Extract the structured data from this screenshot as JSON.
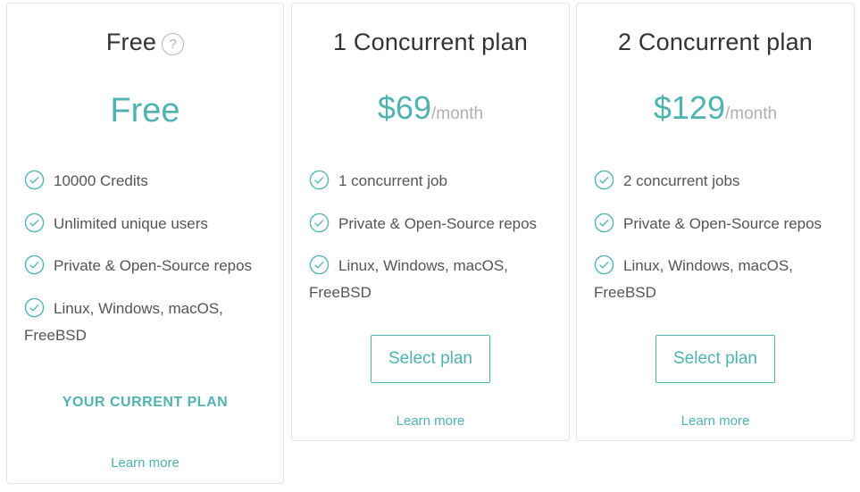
{
  "accent_color": "#4fb3b0",
  "plans": [
    {
      "title": "Free",
      "help_glyph": "?",
      "price_text": "Free",
      "features": [
        "10000 Credits",
        "Unlimited unique users",
        "Private & Open-Source repos",
        "Linux, Windows, macOS, FreeBSD"
      ],
      "status_label": "YOUR CURRENT PLAN",
      "learn_more_label": "Learn more"
    },
    {
      "title": "1 Concurrent plan",
      "price_amount": "$69",
      "price_period": "/month",
      "features": [
        "1 concurrent job",
        "Private & Open-Source repos",
        "Linux, Windows, macOS, FreeBSD"
      ],
      "select_label": "Select plan",
      "learn_more_label": "Learn more"
    },
    {
      "title": "2 Concurrent plan",
      "price_amount": "$129",
      "price_period": "/month",
      "features": [
        "2 concurrent jobs",
        "Private & Open-Source repos",
        "Linux, Windows, macOS, FreeBSD"
      ],
      "select_label": "Select plan",
      "learn_more_label": "Learn more"
    }
  ]
}
